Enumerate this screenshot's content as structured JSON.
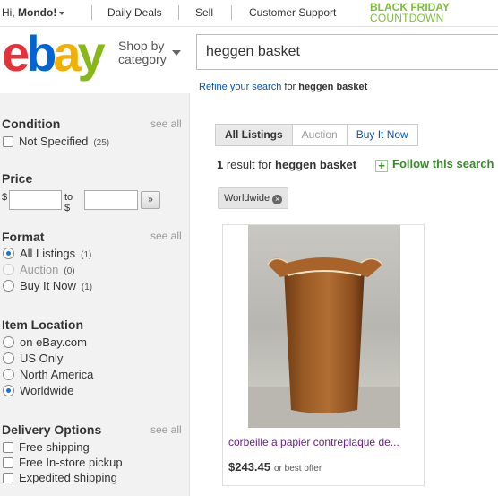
{
  "topbar": {
    "greeting_prefix": "Hi, ",
    "user": "Mondo!",
    "links": [
      "Daily Deals",
      "Sell",
      "Customer Support"
    ],
    "promo_line1": "BLACK FRIDAY",
    "promo_line2": "COUNTDOWN"
  },
  "header": {
    "logo_letters": [
      "e",
      "b",
      "a",
      "y"
    ],
    "shop_by_line1": "Shop by",
    "shop_by_line2": "category",
    "search_value": "heggen basket"
  },
  "refine": {
    "link": "Refine your search",
    "mid": " for ",
    "query": "heggen basket"
  },
  "sidebar": {
    "condition": {
      "title": "Condition",
      "see_all": "see all",
      "options": [
        {
          "label": "Not Specified",
          "count": "(25)"
        }
      ]
    },
    "price": {
      "title": "Price",
      "currency_from": "$",
      "to_label": "to $",
      "go_label": "»",
      "min_value": "",
      "max_value": ""
    },
    "format": {
      "title": "Format",
      "see_all": "see all",
      "options": [
        {
          "label": "All Listings",
          "count": "(1)",
          "selected": true
        },
        {
          "label": "Auction",
          "count": "(0)",
          "disabled": true
        },
        {
          "label": "Buy It Now",
          "count": "(1)"
        }
      ]
    },
    "location": {
      "title": "Item Location",
      "options": [
        {
          "label": "on eBay.com"
        },
        {
          "label": "US Only"
        },
        {
          "label": "North America"
        },
        {
          "label": "Worldwide",
          "selected": true
        }
      ]
    },
    "delivery": {
      "title": "Delivery Options",
      "see_all": "see all",
      "options": [
        {
          "label": "Free shipping"
        },
        {
          "label": "Free In-store pickup"
        },
        {
          "label": "Expedited shipping"
        }
      ]
    }
  },
  "results": {
    "tabs": [
      "All Listings",
      "Auction",
      "Buy It Now"
    ],
    "count": "1",
    "count_mid": " result for ",
    "query": "heggen basket",
    "follow": "Follow this search",
    "chip": "Worldwide",
    "listing": {
      "title": "corbeille a papier contreplaqué de...",
      "price": "$243.45",
      "price_note": "or best offer"
    }
  },
  "colors": {
    "logo_e": "#e53238",
    "logo_b": "#0064d2",
    "logo_a": "#f5af02",
    "logo_y": "#86b817",
    "link": "#0654ba",
    "follow_green": "#3a8a2b",
    "promo_green": "#7bbf3a",
    "listing_title": "#6b1f8f"
  }
}
